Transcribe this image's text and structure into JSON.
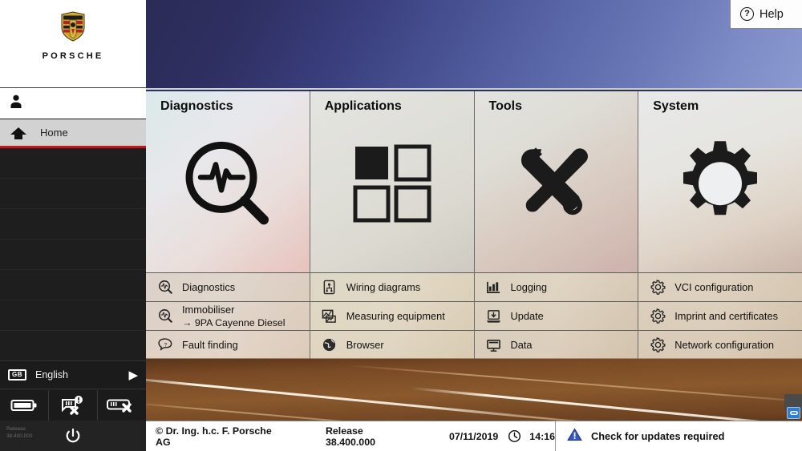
{
  "brand": {
    "wordmark": "PORSCHE",
    "crest_icon": "porsche-crest-icon"
  },
  "help": {
    "label": "Help",
    "icon": "question-mark-icon"
  },
  "sidebar": {
    "user_icon": "user-icon",
    "home": {
      "label": "Home",
      "icon": "home-icon"
    },
    "blank_rows": 7,
    "language": {
      "flag_code": "GB",
      "label": "English",
      "arrow_icon": "chevron-right-icon"
    },
    "status_icons": [
      {
        "name": "battery-icon",
        "state": "ok"
      },
      {
        "name": "vci-disconnected-warning-icon",
        "state": "disconnected"
      },
      {
        "name": "vci-disconnected-icon",
        "state": "disconnected"
      }
    ],
    "power": {
      "icon": "power-icon"
    },
    "release_tag": {
      "line1": "Release",
      "line2": "38.400.000"
    }
  },
  "tiles": [
    {
      "title": "Diagnostics",
      "glyph": "magnifier-pulse-icon",
      "items": [
        {
          "label": "Diagnostics",
          "icon": "magnifier-pulse-small-icon",
          "sub": ""
        },
        {
          "label": "Immobiliser",
          "icon": "magnifier-pulse-small-icon",
          "sub": "→ 9PA Cayenne Diesel"
        },
        {
          "label": "Fault finding",
          "icon": "fault-finding-icon",
          "sub": ""
        }
      ]
    },
    {
      "title": "Applications",
      "glyph": "four-squares-icon",
      "items": [
        {
          "label": "Wiring diagrams",
          "icon": "wiring-diagram-icon",
          "sub": ""
        },
        {
          "label": "Measuring equipment",
          "icon": "measuring-equipment-icon",
          "sub": ""
        },
        {
          "label": "Browser",
          "icon": "globe-icon",
          "sub": ""
        }
      ]
    },
    {
      "title": "Tools",
      "glyph": "wrench-screwdriver-icon",
      "items": [
        {
          "label": "Logging",
          "icon": "bar-chart-icon",
          "sub": ""
        },
        {
          "label": "Update",
          "icon": "download-laptop-icon",
          "sub": ""
        },
        {
          "label": "Data",
          "icon": "monitor-icon",
          "sub": ""
        }
      ]
    },
    {
      "title": "System",
      "glyph": "gear-icon",
      "items": [
        {
          "label": "VCI configuration",
          "icon": "gear-small-icon",
          "sub": ""
        },
        {
          "label": "Imprint and certificates",
          "icon": "gear-small-icon",
          "sub": ""
        },
        {
          "label": "Network configuration",
          "icon": "gear-small-icon",
          "sub": ""
        }
      ]
    }
  ],
  "statusbar": {
    "copyright": "© Dr. Ing. h.c. F. Porsche AG",
    "release": "Release 38.400.000",
    "date": "07/11/2019",
    "clock_icon": "clock-icon",
    "time": "14:16",
    "update_message": "Check for updates required",
    "warning_icon": "warning-triangle-icon",
    "corner_icon": "vci-status-corner-icon"
  },
  "colors": {
    "accent_red": "#c4151c",
    "warning_blue": "#3656c8",
    "sidebar_dark": "#1e1e1e",
    "header_blue": "#3a3f7e",
    "road_brown": "#8d5a2c"
  }
}
